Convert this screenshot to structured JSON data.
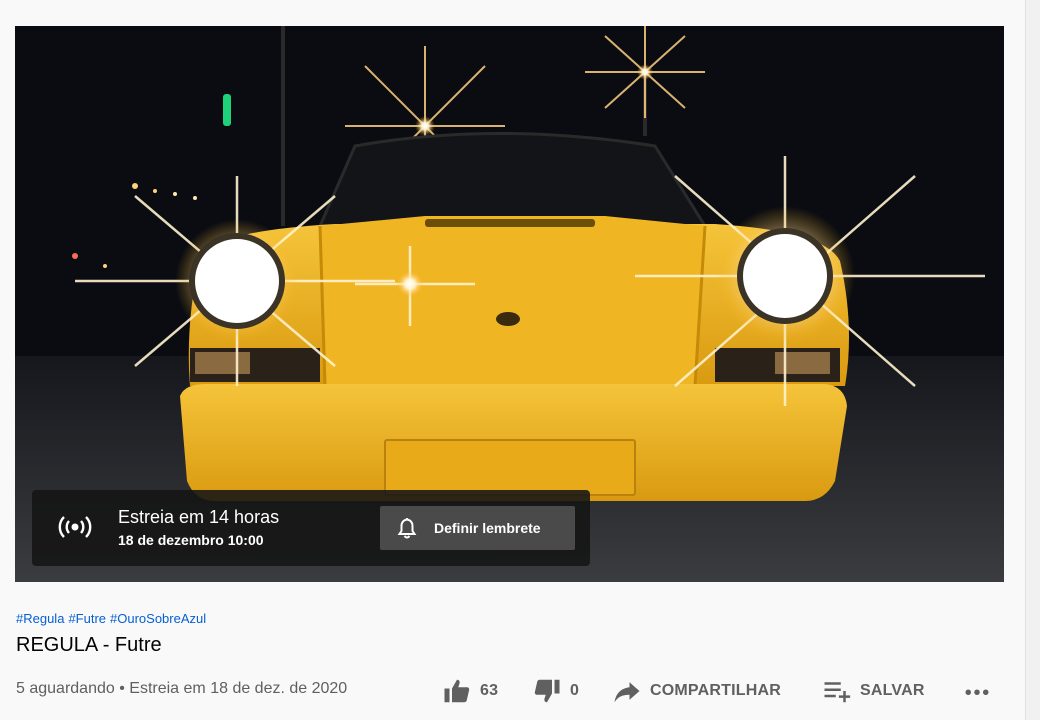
{
  "premiere": {
    "title": "Estreia em 14 horas",
    "date": "18 de dezembro 10:00",
    "reminder_label": "Definir lembrete"
  },
  "hashtags": [
    "#Regula",
    "#Futre",
    "#OuroSobreAzul"
  ],
  "video": {
    "title": "REGULA - Futre",
    "waiting": "5 aguardando",
    "separator": "•",
    "premiere_date": "Estreia em 18 de dez. de 2020"
  },
  "actions": {
    "likes": "63",
    "dislikes": "0",
    "share_label": "COMPARTILHAR",
    "save_label": "SALVAR"
  },
  "icons": {
    "live": "live-broadcast-icon",
    "bell": "bell-icon",
    "like": "thumbs-up-icon",
    "dislike": "thumbs-down-icon",
    "share": "share-arrow-icon",
    "save": "playlist-add-icon",
    "more": "more-horizontal-icon"
  },
  "colors": {
    "car": "#f2b21e",
    "link": "#065fd4",
    "text": "#030303",
    "muted": "#606060"
  }
}
